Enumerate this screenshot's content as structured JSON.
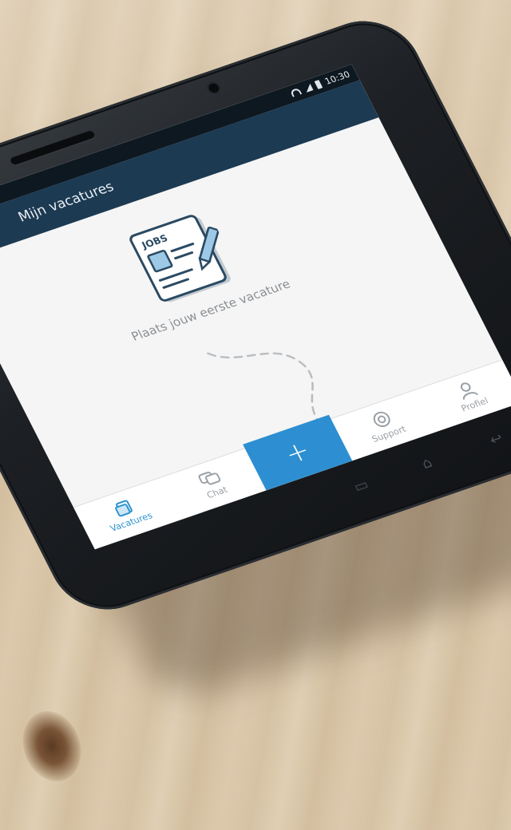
{
  "statusbar": {
    "time": "10:30"
  },
  "appbar": {
    "title": "Mijn vacatures"
  },
  "empty_state": {
    "illustration_label": "JOBS",
    "message": "Plaats jouw eerste vacature"
  },
  "tabbar": {
    "tabs": [
      {
        "label": "Vacatures",
        "icon": "vacatures-icon",
        "active": true
      },
      {
        "label": "Chat",
        "icon": "chat-icon",
        "active": false
      },
      {
        "label": "+",
        "icon": "plus-icon",
        "active": false
      },
      {
        "label": "Support",
        "icon": "support-icon",
        "active": false
      },
      {
        "label": "Profiel",
        "icon": "profile-icon",
        "active": false
      }
    ]
  },
  "colors": {
    "appbar": "#1c3a52",
    "accent": "#2d8fd1",
    "active_tab": "#2b93cf"
  }
}
